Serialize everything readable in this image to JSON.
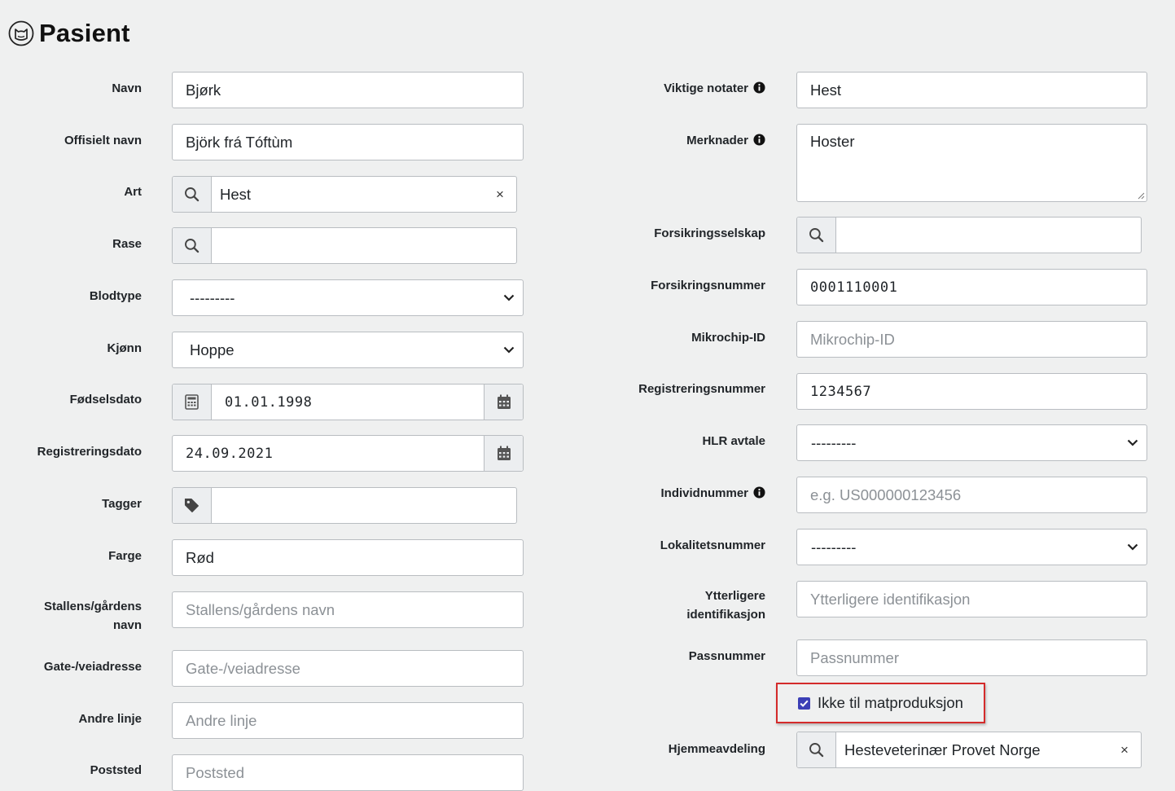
{
  "page": {
    "title": "Pasient",
    "icon": "cat-icon"
  },
  "left_fields": [
    {
      "label": "Navn",
      "value": "Bjørk"
    },
    {
      "label": "Offisielt navn",
      "value": "Björk frá Tóftùm"
    },
    {
      "label": "Art",
      "value": "Hest",
      "clear": "×",
      "icon": "search-icon"
    },
    {
      "label": "Rase",
      "value": "",
      "icon": "search-icon"
    },
    {
      "label": "Blodtype",
      "value": "---------"
    },
    {
      "label": "Kjønn",
      "value": "Hoppe"
    },
    {
      "label": "Fødselsdato",
      "value": "01.01.1998",
      "icon_left": "calculator-icon",
      "icon_right": "calendar-icon"
    },
    {
      "label": "Registreringsdato",
      "value": "24.09.2021",
      "icon_right": "calendar-icon"
    },
    {
      "label": "Tagger",
      "value": "",
      "icon": "tag-icon"
    },
    {
      "label": "Farge",
      "value": "Rød"
    },
    {
      "label": "Stallens/gårdens navn",
      "placeholder": "Stallens/gårdens navn"
    },
    {
      "label": "Gate-/veiadresse",
      "placeholder": "Gate-/veiadresse"
    },
    {
      "label": "Andre linje",
      "placeholder": "Andre linje"
    },
    {
      "label": "Poststed",
      "placeholder": "Poststed"
    }
  ],
  "right_fields": [
    {
      "label": "Viktige notater",
      "value": "Hest",
      "info_icon": "info-icon"
    },
    {
      "label": "Merknader",
      "value": "Hoster",
      "info_icon": "info-icon"
    },
    {
      "label": "Forsikringsselskap",
      "value": "",
      "icon": "search-icon"
    },
    {
      "label": "Forsikringsnummer",
      "value": "0001110001"
    },
    {
      "label": "Mikrochip-ID",
      "placeholder": "Mikrochip-ID"
    },
    {
      "label": "Registreringsnummer",
      "value": "1234567"
    },
    {
      "label": "HLR avtale",
      "value": "---------"
    },
    {
      "label": "Individnummer",
      "placeholder": "e.g. US000000123456",
      "info_icon": "info-icon"
    },
    {
      "label": "Lokalitetsnummer",
      "value": "---------"
    },
    {
      "label": "Ytterligere identifikasjon",
      "placeholder": "Ytterligere identifikasjon"
    },
    {
      "label": "Passnummer",
      "placeholder": "Passnummer"
    },
    {
      "label": "Hjemmeavdeling",
      "value": "Hesteveterinær Provet Norge",
      "clear": "×",
      "icon": "search-icon"
    }
  ],
  "checkbox": {
    "label": "Ikke til matproduksjon",
    "checked": true
  },
  "colors": {
    "background": "#eff0f0",
    "checkbox": "#3b3fb6",
    "highlight": "#d42b2b"
  }
}
